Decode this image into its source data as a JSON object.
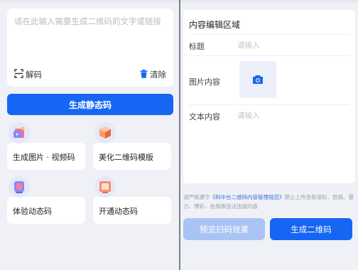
{
  "left_panel": {
    "input": {
      "placeholder": "请在此输入需要生成二维码的文字或链接",
      "value": ""
    },
    "decode_label": "解码",
    "clear_label": "清除",
    "primary_button_label": "生成静态码",
    "features": [
      {
        "label": "生成图片 · 视频码",
        "icon": "sparkle-3d-icon"
      },
      {
        "label": "美化二维码模版",
        "icon": "cube-3d-icon"
      },
      {
        "label": "体验动态码",
        "icon": "mirror-3d-icon"
      },
      {
        "label": "开通动态码",
        "icon": "tablet-3d-icon"
      }
    ]
  },
  "right_panel": {
    "editor_title": "内容编辑区域",
    "fields": [
      {
        "label": "标题",
        "placeholder": "请输入"
      },
      {
        "label": "图片内容",
        "icon": "camera-icon"
      },
      {
        "label": "文本内容",
        "placeholder": "请输入"
      }
    ],
    "notice": {
      "prefix": "请严格遵守",
      "link": "《码中台二维码内容管理规范》",
      "suffix": "禁止上传含有侵权、恐搞、暴力、博彩、色情等违法违规内容"
    },
    "preview_button_label": "预览扫码效果",
    "generate_button_label": "生成二维码"
  },
  "colors": {
    "primary": "#1666f4",
    "primary_disabled": "#a9c4f4",
    "background": "#eff1f6",
    "link": "#3b6fd8"
  }
}
